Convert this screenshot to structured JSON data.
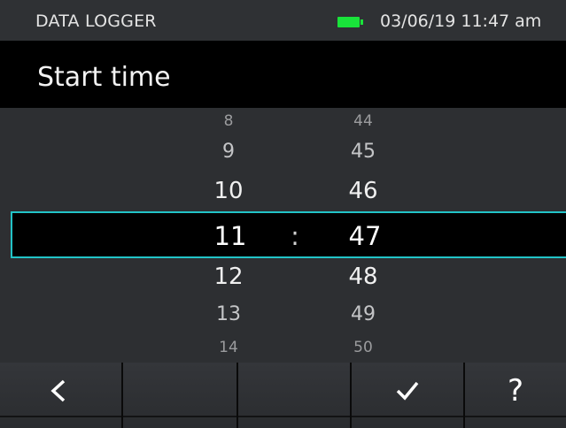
{
  "status": {
    "app_title": "DATA LOGGER",
    "datetime": "03/06/19 11:47 am",
    "battery_color": "#19e33a",
    "battery_icon": "battery-full-icon"
  },
  "header": {
    "title": "Start time"
  },
  "picker": {
    "hours": [
      "8",
      "9",
      "10",
      "11",
      "12",
      "13",
      "14"
    ],
    "minutes": [
      "44",
      "45",
      "46",
      "47",
      "48",
      "49",
      "50"
    ],
    "selected_hour": "11",
    "selected_minute": "47",
    "separator": ":",
    "highlight_color": "#22c3c7"
  },
  "softkeys": {
    "back": {
      "icon": "chevron-left-icon",
      "glyph": "<"
    },
    "key2": "",
    "key3": "",
    "confirm": {
      "icon": "checkmark-icon",
      "glyph": "✓"
    },
    "help": {
      "icon": "question-icon",
      "glyph": "?"
    }
  }
}
